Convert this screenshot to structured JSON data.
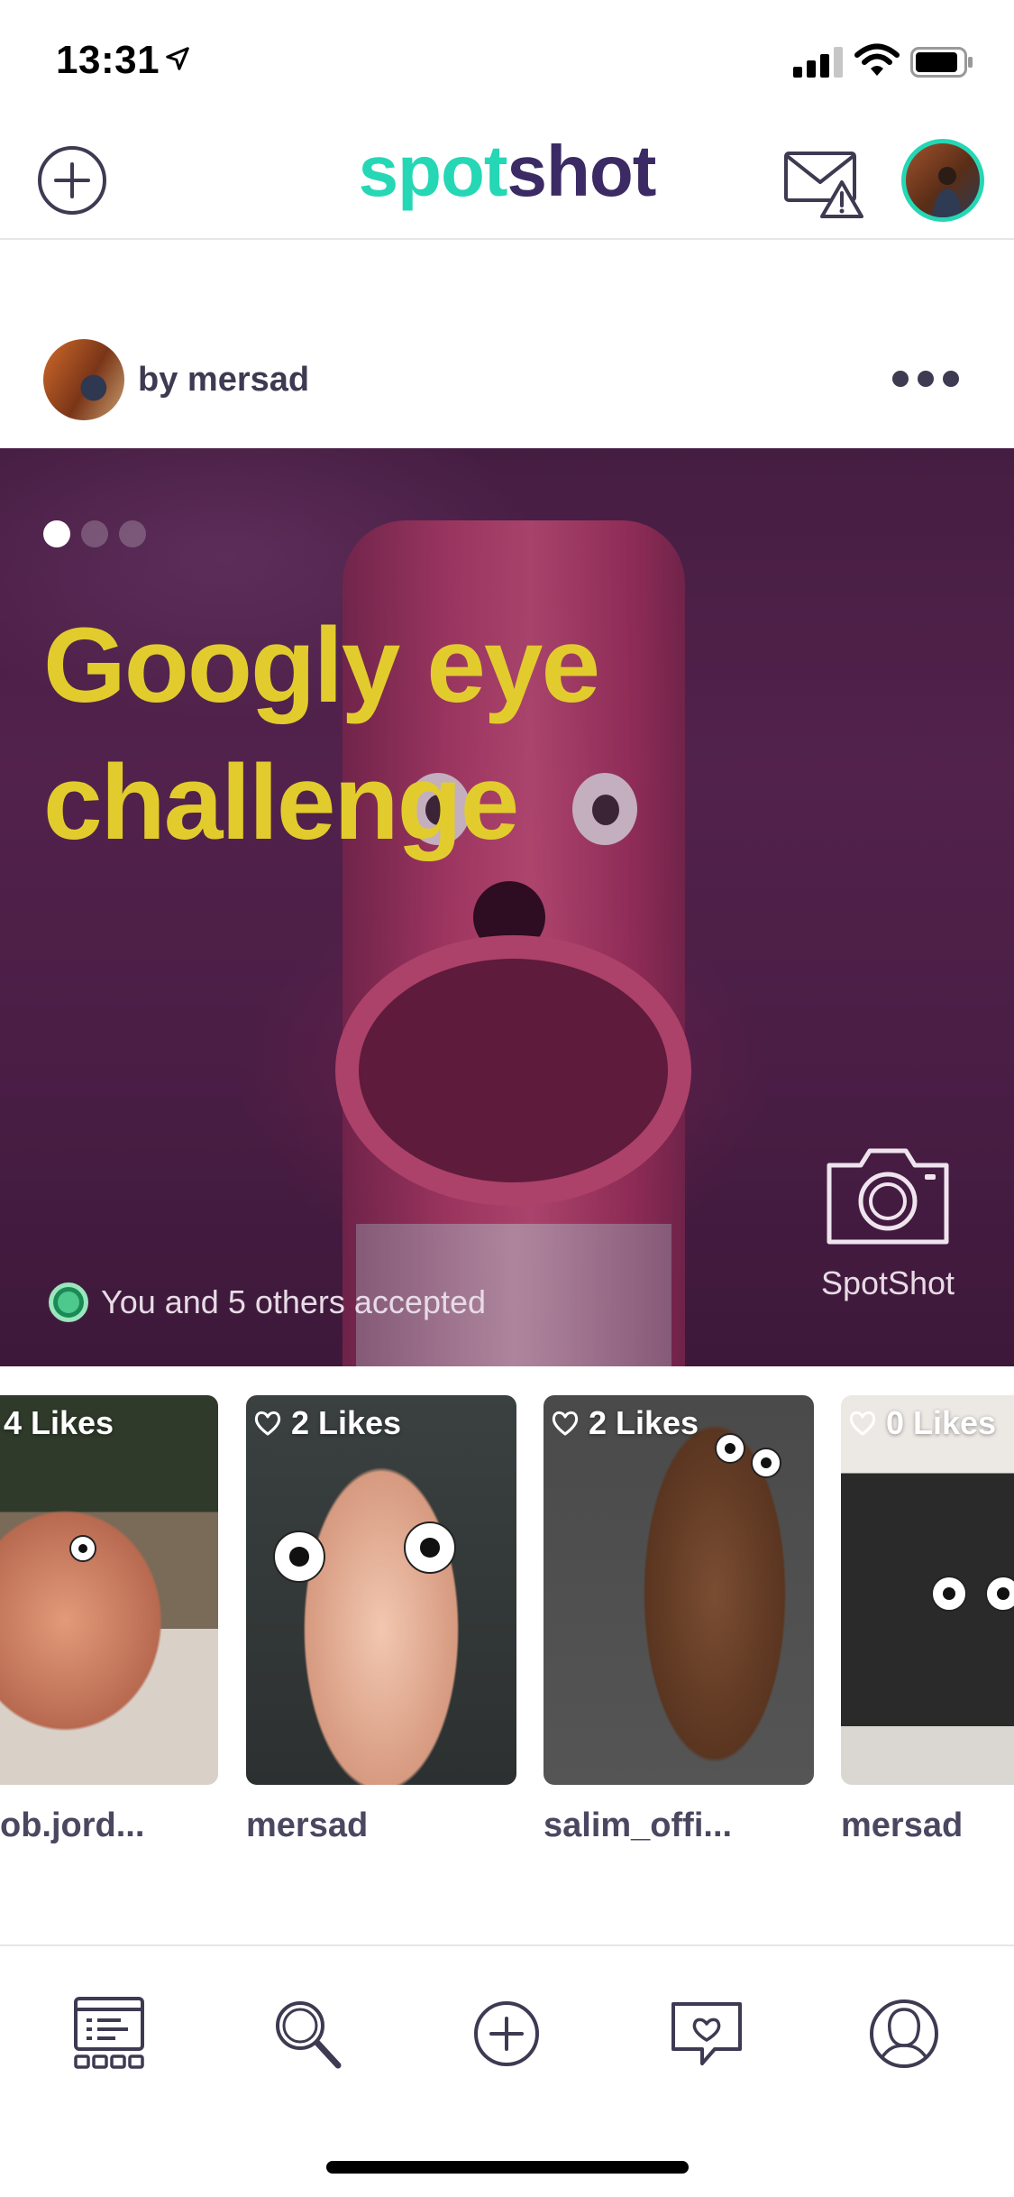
{
  "status_bar": {
    "time": "13:31",
    "icons": [
      "location-arrow-icon",
      "signal-icon",
      "wifi-icon",
      "battery-icon"
    ]
  },
  "header": {
    "logo_part1": "spot",
    "logo_part2": "shot",
    "colors": {
      "logo_primary": "#25d7b4",
      "logo_secondary": "#3b2a63"
    },
    "left_icon": "plus-circle-icon",
    "right_icons": [
      "mail-alert-icon",
      "profile-avatar"
    ]
  },
  "post": {
    "author_label": "by mersad",
    "menu_icon": "more-dots-icon",
    "carousel": {
      "total": 3,
      "active_index": 0
    },
    "title_line1": "Googly eye",
    "title_line2": "challenge",
    "title_color": "#e2cc2d",
    "accepted_text": "You and 5 others accepted",
    "camera_label": "SpotShot"
  },
  "entries": [
    {
      "likes": "4 Likes",
      "username": "ob.jord...",
      "show_heart": false
    },
    {
      "likes": "2 Likes",
      "username": "mersad",
      "show_heart": true
    },
    {
      "likes": "2 Likes",
      "username": "salim_offi...",
      "show_heart": true
    },
    {
      "likes": "0 Likes",
      "username": "mersad",
      "show_heart": true
    }
  ],
  "tabbar": {
    "tabs": [
      "feed-icon",
      "search-icon",
      "add-circle-icon",
      "messages-heart-icon",
      "profile-icon"
    ],
    "color": "#3d3a52"
  }
}
